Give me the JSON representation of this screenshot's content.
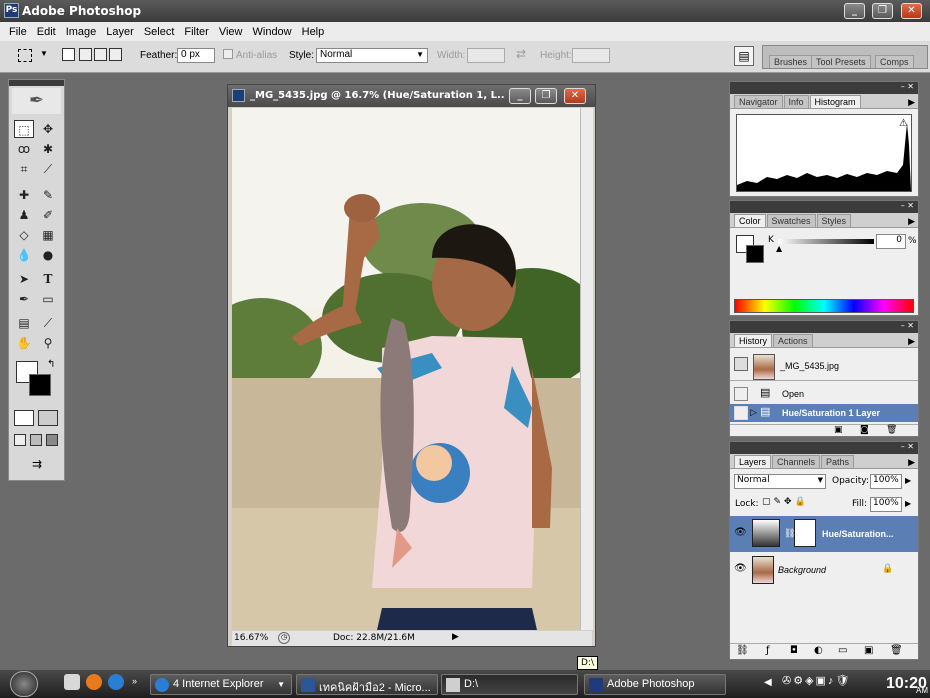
{
  "app": {
    "title": "Adobe Photoshop"
  },
  "menu": [
    "File",
    "Edit",
    "Image",
    "Layer",
    "Select",
    "Filter",
    "View",
    "Window",
    "Help"
  ],
  "options": {
    "feather_label": "Feather:",
    "feather_value": "0 px",
    "antialias_label": "Anti-alias",
    "style_label": "Style:",
    "style_value": "Normal",
    "width_label": "Width:",
    "height_label": "Height:",
    "well_tabs": [
      "Brushes",
      "Tool Presets",
      "Comps"
    ]
  },
  "document": {
    "title": "_MG_5435.jpg @ 16.7% (Hue/Saturation 1, L...",
    "zoom": "16.67%",
    "doc_size": "Doc: 22.8M/21.6M"
  },
  "navigator": {
    "tabs": [
      "Navigator",
      "Info",
      "Histogram"
    ],
    "active": "Histogram"
  },
  "color": {
    "tabs": [
      "Color",
      "Swatches",
      "Styles"
    ],
    "channel_label": "K",
    "value": "0",
    "unit": "%"
  },
  "history": {
    "tabs": [
      "History",
      "Actions"
    ],
    "snapshot": "_MG_5435.jpg",
    "states": [
      "Open",
      "Hue/Saturation 1 Layer"
    ]
  },
  "layers": {
    "tabs": [
      "Layers",
      "Channels",
      "Paths"
    ],
    "blend_mode": "Normal",
    "opacity_label": "Opacity:",
    "opacity": "100%",
    "lock_label": "Lock:",
    "fill_label": "Fill:",
    "fill": "100%",
    "items": [
      {
        "name": "Hue/Saturation...",
        "selected": true
      },
      {
        "name": "Background",
        "selected": false
      }
    ]
  },
  "tooltip": "D:\\",
  "taskbar": {
    "ie_label": "4 Internet Explorer",
    "tasks": [
      "เทคนิคฝ้ามือ2 - Micro...",
      "D:\\",
      "Adobe Photoshop"
    ],
    "clock": "10:20",
    "ampm": "AM"
  },
  "colors": {
    "selection": "#5b7fb5",
    "titlebar": "#3a3a3a"
  }
}
